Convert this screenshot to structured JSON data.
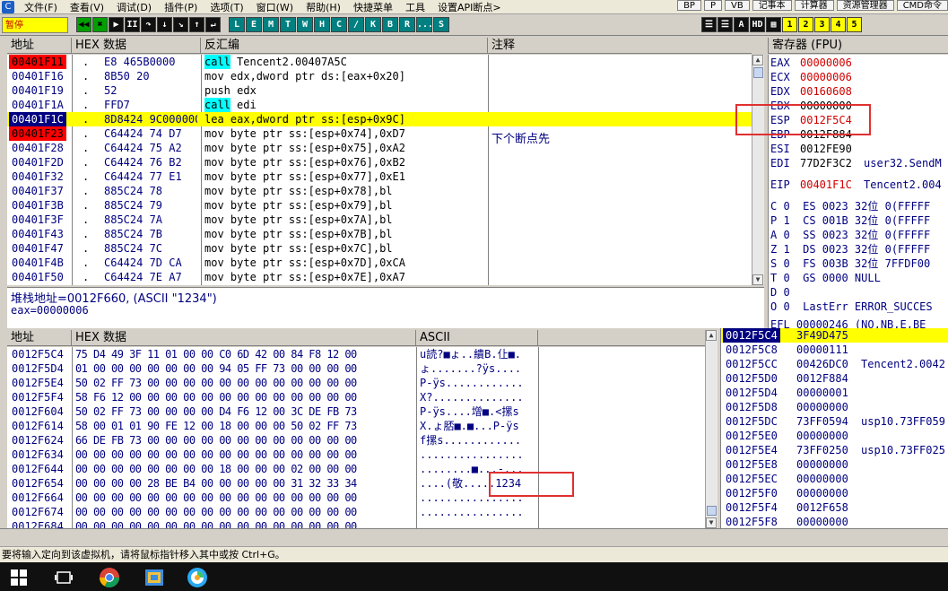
{
  "menu": {
    "items": [
      "文件(F)",
      "查看(V)",
      "调试(D)",
      "插件(P)",
      "选项(T)",
      "窗口(W)",
      "帮助(H)",
      "快捷菜单",
      "工具",
      "设置API断点>"
    ],
    "right_buttons": [
      "BP",
      "P",
      "VB",
      "记事本",
      "计算器",
      "资源管理器",
      "CMD命令"
    ]
  },
  "toolbar": {
    "status": "暂停",
    "nav": [
      "◀◀",
      "✖",
      "▶",
      "II",
      "↷",
      "↓",
      "↘",
      "↑",
      "↵"
    ],
    "letters": [
      "L",
      "E",
      "M",
      "T",
      "W",
      "H",
      "C",
      "/",
      "K",
      "B",
      "R",
      "...",
      "S"
    ],
    "right": [
      "☰",
      "☰",
      "A",
      "HD",
      "▦",
      "1",
      "2",
      "3",
      "4",
      "5"
    ]
  },
  "disasm": {
    "headers": {
      "addr": "地址",
      "hex": "HEX 数据",
      "dis": "反汇编",
      "comment": "注释"
    },
    "rows": [
      {
        "addr": "00401F11",
        "dot": ".",
        "hex": "E8 465B0000",
        "mnemonic": "call",
        "operands": " Tencent2.00407A5C",
        "comment": "",
        "state": "bp",
        "kw": true
      },
      {
        "addr": "00401F16",
        "dot": ".",
        "hex": "8B50 20",
        "mnemonic": "mov edx,dword ptr ds:[eax+0x20]",
        "operands": "",
        "comment": "",
        "state": "",
        "kw": false
      },
      {
        "addr": "00401F19",
        "dot": ".",
        "hex": "52",
        "mnemonic": "push edx",
        "operands": "",
        "comment": "",
        "state": "",
        "kw": false
      },
      {
        "addr": "00401F1A",
        "dot": ".",
        "hex": "FFD7",
        "mnemonic": "call",
        "operands": " edi",
        "comment": "",
        "state": "",
        "kw": true
      },
      {
        "addr": "00401F1C",
        "dot": ".",
        "hex": "8D8424 9C000000",
        "mnemonic": "lea eax,dword ptr ss:[esp+0x9C]",
        "operands": "",
        "comment": "",
        "state": "current",
        "kw": false
      },
      {
        "addr": "00401F23",
        "dot": ".",
        "hex": "C64424 74 D7",
        "mnemonic": "mov byte ptr ss:[esp+0x74],0xD7",
        "operands": "",
        "comment": "下个断点先",
        "state": "bp",
        "kw": false
      },
      {
        "addr": "00401F28",
        "dot": ".",
        "hex": "C64424 75 A2",
        "mnemonic": "mov byte ptr ss:[esp+0x75],0xA2",
        "operands": "",
        "comment": "",
        "state": "",
        "kw": false
      },
      {
        "addr": "00401F2D",
        "dot": ".",
        "hex": "C64424 76 B2",
        "mnemonic": "mov byte ptr ss:[esp+0x76],0xB2",
        "operands": "",
        "comment": "",
        "state": "",
        "kw": false
      },
      {
        "addr": "00401F32",
        "dot": ".",
        "hex": "C64424 77 E1",
        "mnemonic": "mov byte ptr ss:[esp+0x77],0xE1",
        "operands": "",
        "comment": "",
        "state": "",
        "kw": false
      },
      {
        "addr": "00401F37",
        "dot": ".",
        "hex": "885C24 78",
        "mnemonic": "mov byte ptr ss:[esp+0x78],bl",
        "operands": "",
        "comment": "",
        "state": "",
        "kw": false
      },
      {
        "addr": "00401F3B",
        "dot": ".",
        "hex": "885C24 79",
        "mnemonic": "mov byte ptr ss:[esp+0x79],bl",
        "operands": "",
        "comment": "",
        "state": "",
        "kw": false
      },
      {
        "addr": "00401F3F",
        "dot": ".",
        "hex": "885C24 7A",
        "mnemonic": "mov byte ptr ss:[esp+0x7A],bl",
        "operands": "",
        "comment": "",
        "state": "",
        "kw": false
      },
      {
        "addr": "00401F43",
        "dot": ".",
        "hex": "885C24 7B",
        "mnemonic": "mov byte ptr ss:[esp+0x7B],bl",
        "operands": "",
        "comment": "",
        "state": "",
        "kw": false
      },
      {
        "addr": "00401F47",
        "dot": ".",
        "hex": "885C24 7C",
        "mnemonic": "mov byte ptr ss:[esp+0x7C],bl",
        "operands": "",
        "comment": "",
        "state": "",
        "kw": false
      },
      {
        "addr": "00401F4B",
        "dot": ".",
        "hex": "C64424 7D CA",
        "mnemonic": "mov byte ptr ss:[esp+0x7D],0xCA",
        "operands": "",
        "comment": "",
        "state": "",
        "kw": false
      },
      {
        "addr": "00401F50",
        "dot": ".",
        "hex": "C64424 7E A7",
        "mnemonic": "mov byte ptr ss:[esp+0x7E],0xA7",
        "operands": "",
        "comment": "",
        "state": "",
        "kw": false
      }
    ]
  },
  "info": {
    "line1": "堆栈地址=0012F660, (ASCII \"1234\")",
    "line2": "eax=00000006"
  },
  "registers": {
    "title": "寄存器 (FPU)",
    "lines": [
      {
        "text": "EAX  00000006",
        "name": "EAX",
        "val": "00000006",
        "extra": "",
        "red": true
      },
      {
        "text": "",
        "name": "ECX",
        "val": "00000006",
        "extra": "",
        "red": true
      },
      {
        "text": "",
        "name": "EDX",
        "val": "00160608",
        "extra": "",
        "red": true
      },
      {
        "text": "",
        "name": "EBX",
        "val": "00000000",
        "extra": "",
        "red": false
      },
      {
        "text": "",
        "name": "ESP",
        "val": "0012F5C4",
        "extra": "",
        "red": true
      },
      {
        "text": "",
        "name": "EBP",
        "val": "0012F884",
        "extra": "",
        "red": false
      },
      {
        "text": "",
        "name": "ESI",
        "val": "0012FE90",
        "extra": "",
        "red": false
      },
      {
        "text": "",
        "name": "EDI",
        "val": "77D2F3C2",
        "extra": "user32.SendM",
        "red": false
      },
      {
        "text": "",
        "name": "",
        "val": "",
        "extra": "",
        "red": false
      },
      {
        "text": "",
        "name": "EIP",
        "val": "00401F1C",
        "extra": "Tencent2.004",
        "red": true
      }
    ],
    "flags": [
      "C 0  ES 0023 32位 0(FFFFF",
      "P 1  CS 001B 32位 0(FFFFF",
      "A 0  SS 0023 32位 0(FFFFF",
      "Z 1  DS 0023 32位 0(FFFFF",
      "S 0  FS 003B 32位 7FFDF00",
      "T 0  GS 0000 NULL",
      "D 0",
      "O 0  LastErr ERROR_SUCCES"
    ],
    "cut_line": "EFL 00000246 (NO,NB,E,BE"
  },
  "dump": {
    "headers": {
      "addr": "地址",
      "hex": "HEX 数据",
      "ascii": "ASCII"
    },
    "rows": [
      {
        "addr": "0012F5C4",
        "hex": "75 D4 49 3F 11 01 00 00 C0 6D 42 00 84 F8 12 00",
        "ascii": "u読?■ょ..繢B.仩■."
      },
      {
        "addr": "0012F5D4",
        "hex": "01 00 00 00 00 00 00 00 94 05 FF 73 00 00 00 00",
        "ascii": "ょ.......?ÿs...."
      },
      {
        "addr": "0012F5E4",
        "hex": "50 02 FF 73 00 00 00 00 00 00 00 00 00 00 00 00",
        "ascii": "P-ÿs............"
      },
      {
        "addr": "0012F5F4",
        "hex": "58 F6 12 00 00 00 00 00 00 00 00 00 00 00 00 00",
        "ascii": "X?.............."
      },
      {
        "addr": "0012F604",
        "hex": "50 02 FF 73 00 00 00 00 D4 F6 12 00 3C DE FB 73",
        "ascii": "P-ÿs....增■.<摞s"
      },
      {
        "addr": "0012F614",
        "hex": "58 00 01 01 90 FE 12 00 18 00 00 00 50 02 FF 73",
        "ascii": "X.ょ脴■.■...P-ÿs"
      },
      {
        "addr": "0012F624",
        "hex": "66 DE FB 73 00 00 00 00 00 00 00 00 00 00 00 00",
        "ascii": "f摞s............"
      },
      {
        "addr": "0012F634",
        "hex": "00 00 00 00 00 00 00 00 00 00 00 00 00 00 00 00",
        "ascii": "................"
      },
      {
        "addr": "0012F644",
        "hex": "00 00 00 00 00 00 00 00 18 00 00 00 02 00 00 00",
        "ascii": "........■...-..."
      },
      {
        "addr": "0012F654",
        "hex": "00 00 00 00 28 BE B4 00 00 00 00 00 31 32 33 34",
        "ascii": "....(敬.....1234"
      },
      {
        "addr": "0012F664",
        "hex": "00 00 00 00 00 00 00 00 00 00 00 00 00 00 00 00",
        "ascii": "................"
      },
      {
        "addr": "0012F674",
        "hex": "00 00 00 00 00 00 00 00 00 00 00 00 00 00 00 00",
        "ascii": "................"
      },
      {
        "addr": "0012F684",
        "hex": "00 00 00 00 00 00 00 00 00 00 00 00 00 00 00 00",
        "ascii": "................"
      }
    ]
  },
  "stack": {
    "rows": [
      {
        "addr": "0012F5C4",
        "val": "3F49D475",
        "comment": "",
        "sel": true
      },
      {
        "addr": "0012F5C8",
        "val": "00000111",
        "comment": "",
        "sel": false
      },
      {
        "addr": "0012F5CC",
        "val": "00426DC0",
        "comment": "Tencent2.0042",
        "sel": false
      },
      {
        "addr": "0012F5D0",
        "val": "0012F884",
        "comment": "",
        "sel": false
      },
      {
        "addr": "0012F5D4",
        "val": "00000001",
        "comment": "",
        "sel": false
      },
      {
        "addr": "0012F5D8",
        "val": "00000000",
        "comment": "",
        "sel": false
      },
      {
        "addr": "0012F5DC",
        "val": "73FF0594",
        "comment": "usp10.73FF059",
        "sel": false
      },
      {
        "addr": "0012F5E0",
        "val": "00000000",
        "comment": "",
        "sel": false
      },
      {
        "addr": "0012F5E4",
        "val": "73FF0250",
        "comment": "usp10.73FF025",
        "sel": false
      },
      {
        "addr": "0012F5E8",
        "val": "00000000",
        "comment": "",
        "sel": false
      },
      {
        "addr": "0012F5EC",
        "val": "00000000",
        "comment": "",
        "sel": false
      },
      {
        "addr": "0012F5F0",
        "val": "00000000",
        "comment": "",
        "sel": false
      },
      {
        "addr": "0012F5F4",
        "val": "0012F658",
        "comment": "",
        "sel": false
      },
      {
        "addr": "0012F5F8",
        "val": "00000000",
        "comment": "",
        "sel": false
      }
    ]
  },
  "statusbar": {
    "text": "要将输入定向到该虚拟机，请将鼠标指针移入其中或按 Ctrl+G。"
  },
  "taskbar": {
    "icons": [
      "windows-start-icon",
      "task-view-icon",
      "chrome-icon",
      "files-icon",
      "qq-browser-icon"
    ]
  },
  "colors": {
    "breakpoint": "#ff0000",
    "current_line": "#ffff00",
    "selected_addr": "#000080",
    "keyword": "#00ffff",
    "annotation_box": "#e03030"
  }
}
